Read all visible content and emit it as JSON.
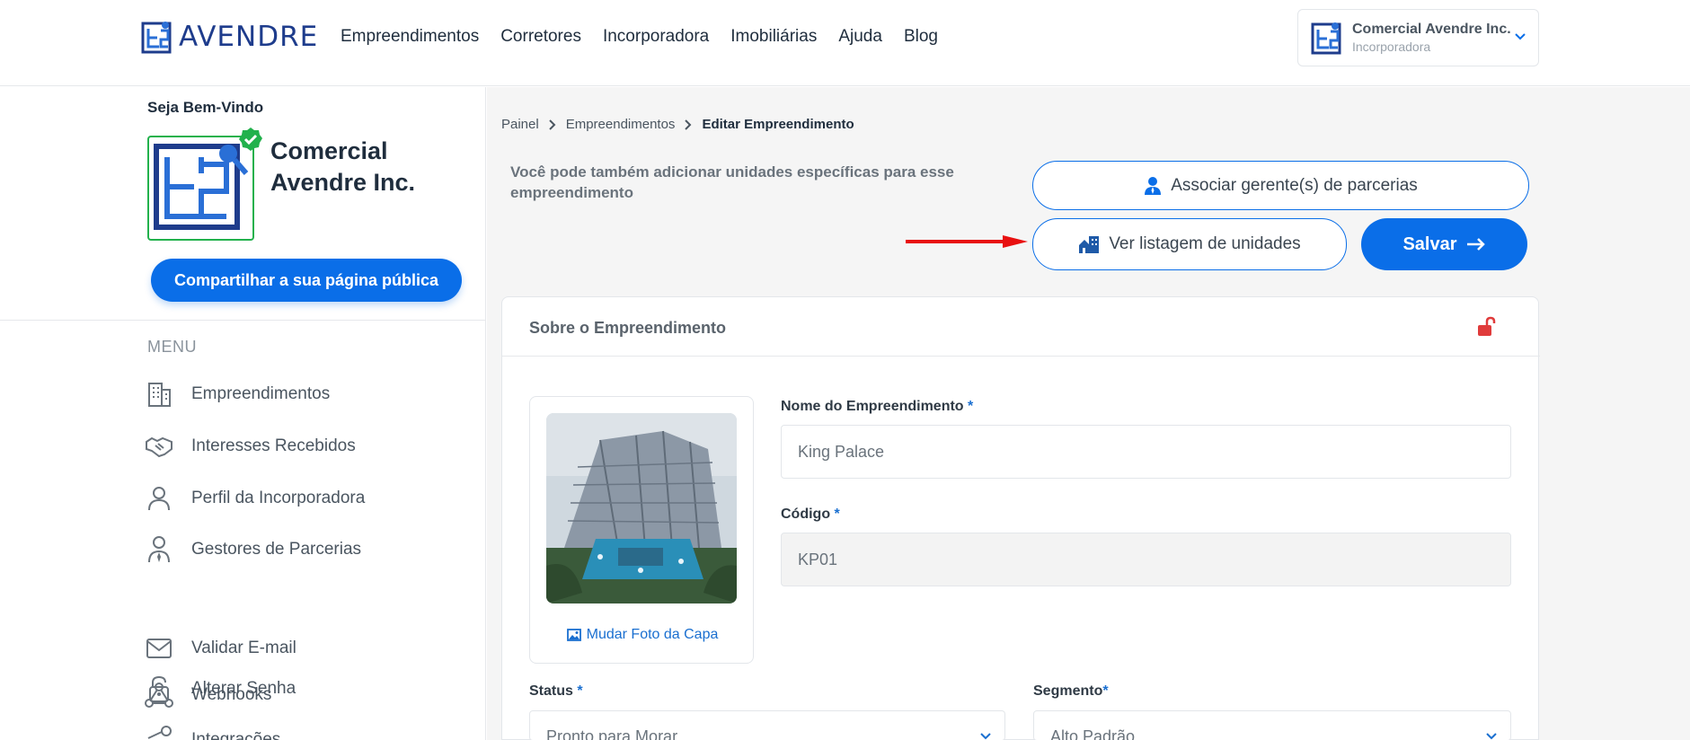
{
  "header": {
    "brand": "AVENDRE",
    "nav": [
      "Empreendimentos",
      "Corretores",
      "Incorporadora",
      "Imobiliárias",
      "Ajuda",
      "Blog"
    ],
    "account": {
      "name": "Comercial Avendre Inc.",
      "role": "Incorporadora"
    }
  },
  "sidebar": {
    "welcome": "Seja Bem-Vindo",
    "company_name": "Comercial Avendre Inc.",
    "share_button": "Compartilhar a sua página pública",
    "menu_title": "MENU",
    "items": [
      {
        "label": "Empreendimentos",
        "icon": "building-icon"
      },
      {
        "label": "Interesses Recebidos",
        "icon": "handshake-icon"
      },
      {
        "label": "Perfil da Incorporadora",
        "icon": "user-icon"
      },
      {
        "label": "Gestores de Parcerias",
        "icon": "user-tie-icon"
      },
      {
        "label": "Alterar Senha",
        "icon": "unlock-icon"
      },
      {
        "label": "Validar E-mail",
        "icon": "envelope-icon"
      },
      {
        "label": "Webhooks",
        "icon": "webhook-icon"
      },
      {
        "label": "Integrações",
        "icon": "integration-icon"
      }
    ]
  },
  "breadcrumb": [
    "Painel",
    "Empreendimentos",
    "Editar Empreendimento"
  ],
  "intro": "Você pode também adicionar unidades específicas para esse empreendimento",
  "buttons": {
    "associate": "Associar gerente(s) de parcerias",
    "list_units": "Ver listagem de unidades",
    "save": "Salvar"
  },
  "card": {
    "title": "Sobre o Empreendimento",
    "change_photo": "Mudar Foto da Capa",
    "fields": {
      "name_label": "Nome do Empreendimento",
      "name_value": "King Palace",
      "code_label": "Código",
      "code_value": "KP01",
      "status_label": "Status",
      "status_value": "Pronto para Morar",
      "segment_label": "Segmento",
      "segment_value": "Alto Padrão",
      "required_mark": "*"
    }
  },
  "colors": {
    "primary": "#0a6ee8",
    "brand_dark": "#1e3c8c",
    "verified": "#22b14c",
    "alert": "#e03b3b"
  }
}
